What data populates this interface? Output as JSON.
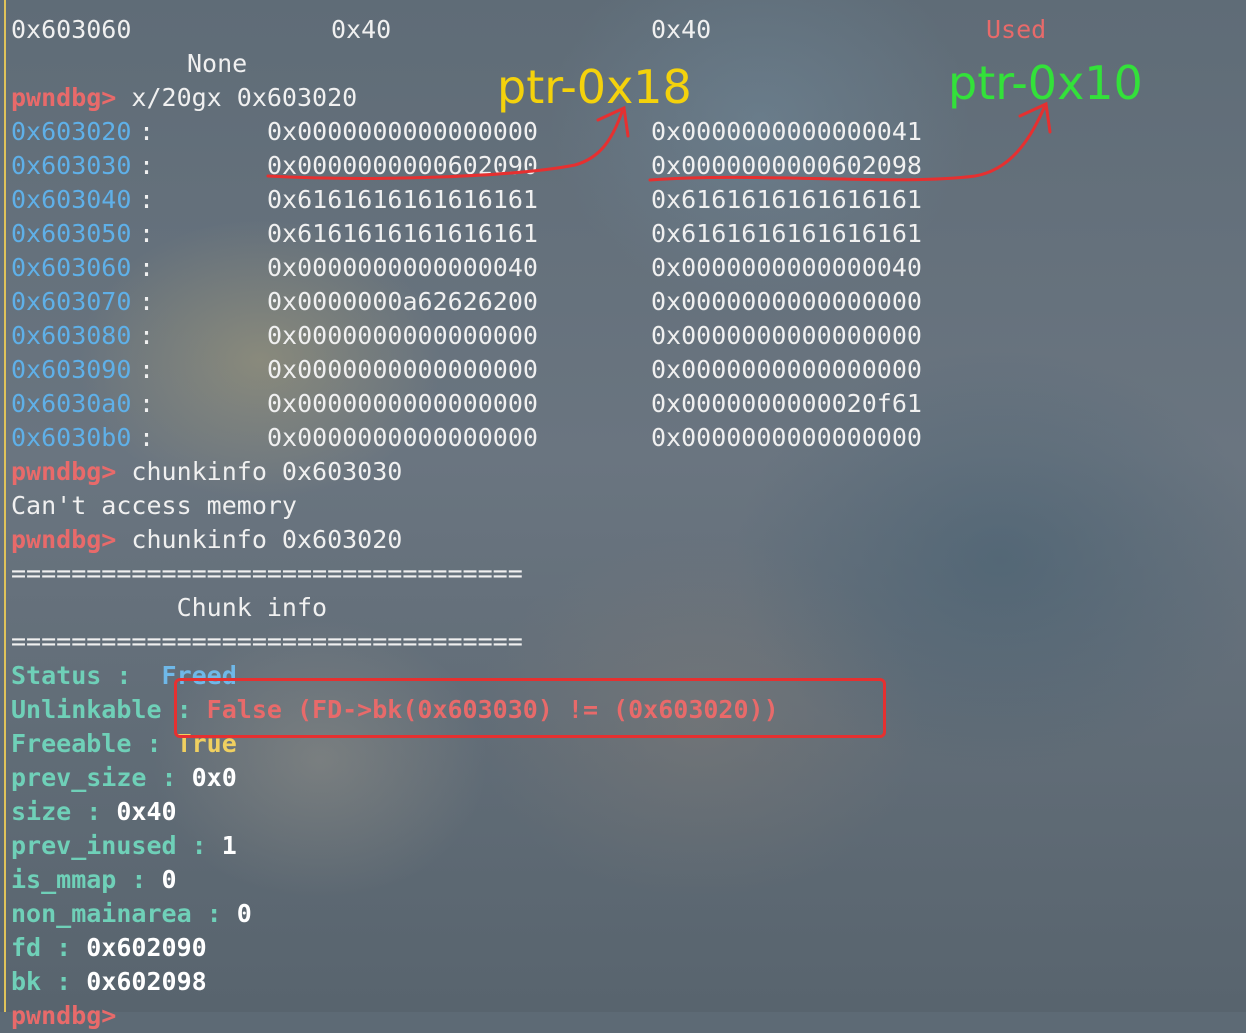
{
  "top_line": {
    "col0": "0x603060",
    "col1": "0x40",
    "col2": "0x40",
    "col3": "Used"
  },
  "none_text": "None",
  "prompt": "pwndbg>",
  "cmd1": " x/20gx 0x603020",
  "memory_rows": [
    {
      "addr": "0x603020",
      "w1": "0x0000000000000000",
      "w2": "0x0000000000000041"
    },
    {
      "addr": "0x603030",
      "w1": "0x0000000000602090",
      "w2": "0x0000000000602098"
    },
    {
      "addr": "0x603040",
      "w1": "0x6161616161616161",
      "w2": "0x6161616161616161"
    },
    {
      "addr": "0x603050",
      "w1": "0x6161616161616161",
      "w2": "0x6161616161616161"
    },
    {
      "addr": "0x603060",
      "w1": "0x0000000000000040",
      "w2": "0x0000000000000040"
    },
    {
      "addr": "0x603070",
      "w1": "0x0000000a62626200",
      "w2": "0x0000000000000000"
    },
    {
      "addr": "0x603080",
      "w1": "0x0000000000000000",
      "w2": "0x0000000000000000"
    },
    {
      "addr": "0x603090",
      "w1": "0x0000000000000000",
      "w2": "0x0000000000000000"
    },
    {
      "addr": "0x6030a0",
      "w1": "0x0000000000000000",
      "w2": "0x0000000000020f61"
    },
    {
      "addr": "0x6030b0",
      "w1": "0x0000000000000000",
      "w2": "0x0000000000000000"
    }
  ],
  "addr_suffix": ":",
  "cmd2": " chunkinfo 0x603030",
  "error_text": "Can't access memory",
  "cmd3": " chunkinfo 0x603020",
  "separator": "==================================",
  "chunk_info_title": "           Chunk info",
  "chunk_info": {
    "status_key": "Status",
    "status_sep": " :  ",
    "status_val": "Freed",
    "unlinkable_key": "Unlinkable",
    "unlinkable_sep": " : ",
    "unlinkable_val": "False (FD->bk(0x603030) != (0x603020))",
    "freeable_key": "Freeable",
    "freeable_sep": " : ",
    "freeable_val": "True",
    "prev_size_key": "prev_size",
    "prev_size_val": "0x0",
    "size_key": "size",
    "size_val": "0x40",
    "prev_inused_key": "prev_inused",
    "prev_inused_val": "1",
    "is_mmap_key": "is_mmap",
    "is_mmap_val": "0",
    "non_mainarea_key": "non_mainarea",
    "non_mainarea_val": "0",
    "fd_key": "fd",
    "fd_val": "0x602090",
    "bk_key": "bk",
    "bk_val": "0x602098",
    "kv_sep": " : "
  },
  "annotations": {
    "fd_note": "ptr-0x18",
    "bk_note": "ptr-0x10",
    "fd_note_color": "#f4d20c",
    "bk_note_color": "#33e13a",
    "mark_color": "#e63030"
  }
}
